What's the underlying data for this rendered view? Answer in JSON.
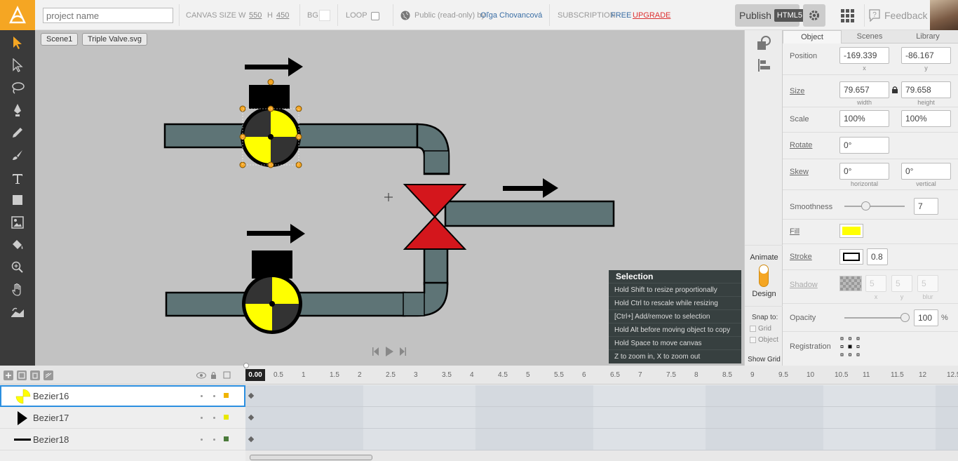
{
  "topbar": {
    "project_placeholder": "project name",
    "canvas_size_label": "CANVAS SIZE",
    "w_label": "W",
    "w_value": "550",
    "h_label": "H",
    "h_value": "450",
    "bg_label": "BG",
    "loop_label": "LOOP",
    "public_text": "Public (read-only) by",
    "author": "Oľga Chovancová",
    "subscription_label": "SUBSCRIPTION:",
    "subscription_plan": "FREE",
    "upgrade": "UPGRADE",
    "publish_label": "Publish",
    "publish_badge": "HTML5",
    "feedback_label": "Feedback",
    "bg_color": "#ffffff"
  },
  "toolbar": {
    "tools": [
      "select-arrow-icon",
      "direct-select-icon",
      "lasso-icon",
      "pen-icon",
      "pencil-icon",
      "brush-icon",
      "text-icon",
      "rectangle-icon",
      "image-icon",
      "paint-bucket-icon",
      "zoom-icon",
      "hand-icon",
      "eyedropper-icon"
    ]
  },
  "canvas": {
    "breadcrumbs": [
      "Scene1",
      "Triple Valve.svg"
    ],
    "background": "#c2c2c2"
  },
  "tips": {
    "title": "Selection",
    "lines": [
      "Hold Shift to resize proportionally",
      "Hold Ctrl to rescale while resizing",
      "[Ctrl+] Add/remove to selection",
      "Hold Alt before moving object to copy",
      "Hold Space to move canvas",
      "Z to zoom in, X to zoom out"
    ]
  },
  "midstrip": {
    "animate_label": "Animate",
    "design_label": "Design",
    "snap_label": "Snap to:",
    "snap_grid": "Grid",
    "snap_object": "Object",
    "show_grid": "Show Grid"
  },
  "panel": {
    "tabs": [
      "Object",
      "Scenes",
      "Library"
    ],
    "position_label": "Position",
    "pos_x": "-169.339",
    "pos_y": "-86.167",
    "x_label": "x",
    "y_label": "y",
    "size_label": "Size",
    "width": "79.657",
    "height": "79.658",
    "width_label": "width",
    "height_label": "height",
    "scale_label": "Scale",
    "scale_x": "100%",
    "scale_y": "100%",
    "rotate_label": "Rotate",
    "rotate": "0°",
    "skew_label": "Skew",
    "skew_h": "0°",
    "skew_v": "0°",
    "skew_h_label": "horizontal",
    "skew_v_label": "vertical",
    "smoothness_label": "Smoothness",
    "smoothness": "7",
    "fill_label": "Fill",
    "fill_color": "#ffff00",
    "stroke_label": "Stroke",
    "stroke_width": "0.8",
    "shadow_label": "Shadow",
    "shadow_x": "5",
    "shadow_y": "5",
    "shadow_blur": "5",
    "blur_label": "blur",
    "opacity_label": "Opacity",
    "opacity": "100",
    "percent": "%",
    "registration_label": "Registration"
  },
  "timeline": {
    "current_time": "0.00",
    "ticks": [
      "0.5",
      "1",
      "1.5",
      "2",
      "2.5",
      "3",
      "3.5",
      "4",
      "4.5",
      "5",
      "5.5",
      "6",
      "6.5",
      "7",
      "7.5",
      "8",
      "8.5",
      "9",
      "9.5",
      "10",
      "10.5",
      "11",
      "11.5",
      "12",
      "12.5"
    ],
    "layers": [
      {
        "name": "Bezier16",
        "color": "#f0b400",
        "selected": true
      },
      {
        "name": "Bezier17",
        "color": "#e8e800",
        "selected": false
      },
      {
        "name": "Bezier18",
        "color": "#4a7a3a",
        "selected": false
      }
    ]
  }
}
